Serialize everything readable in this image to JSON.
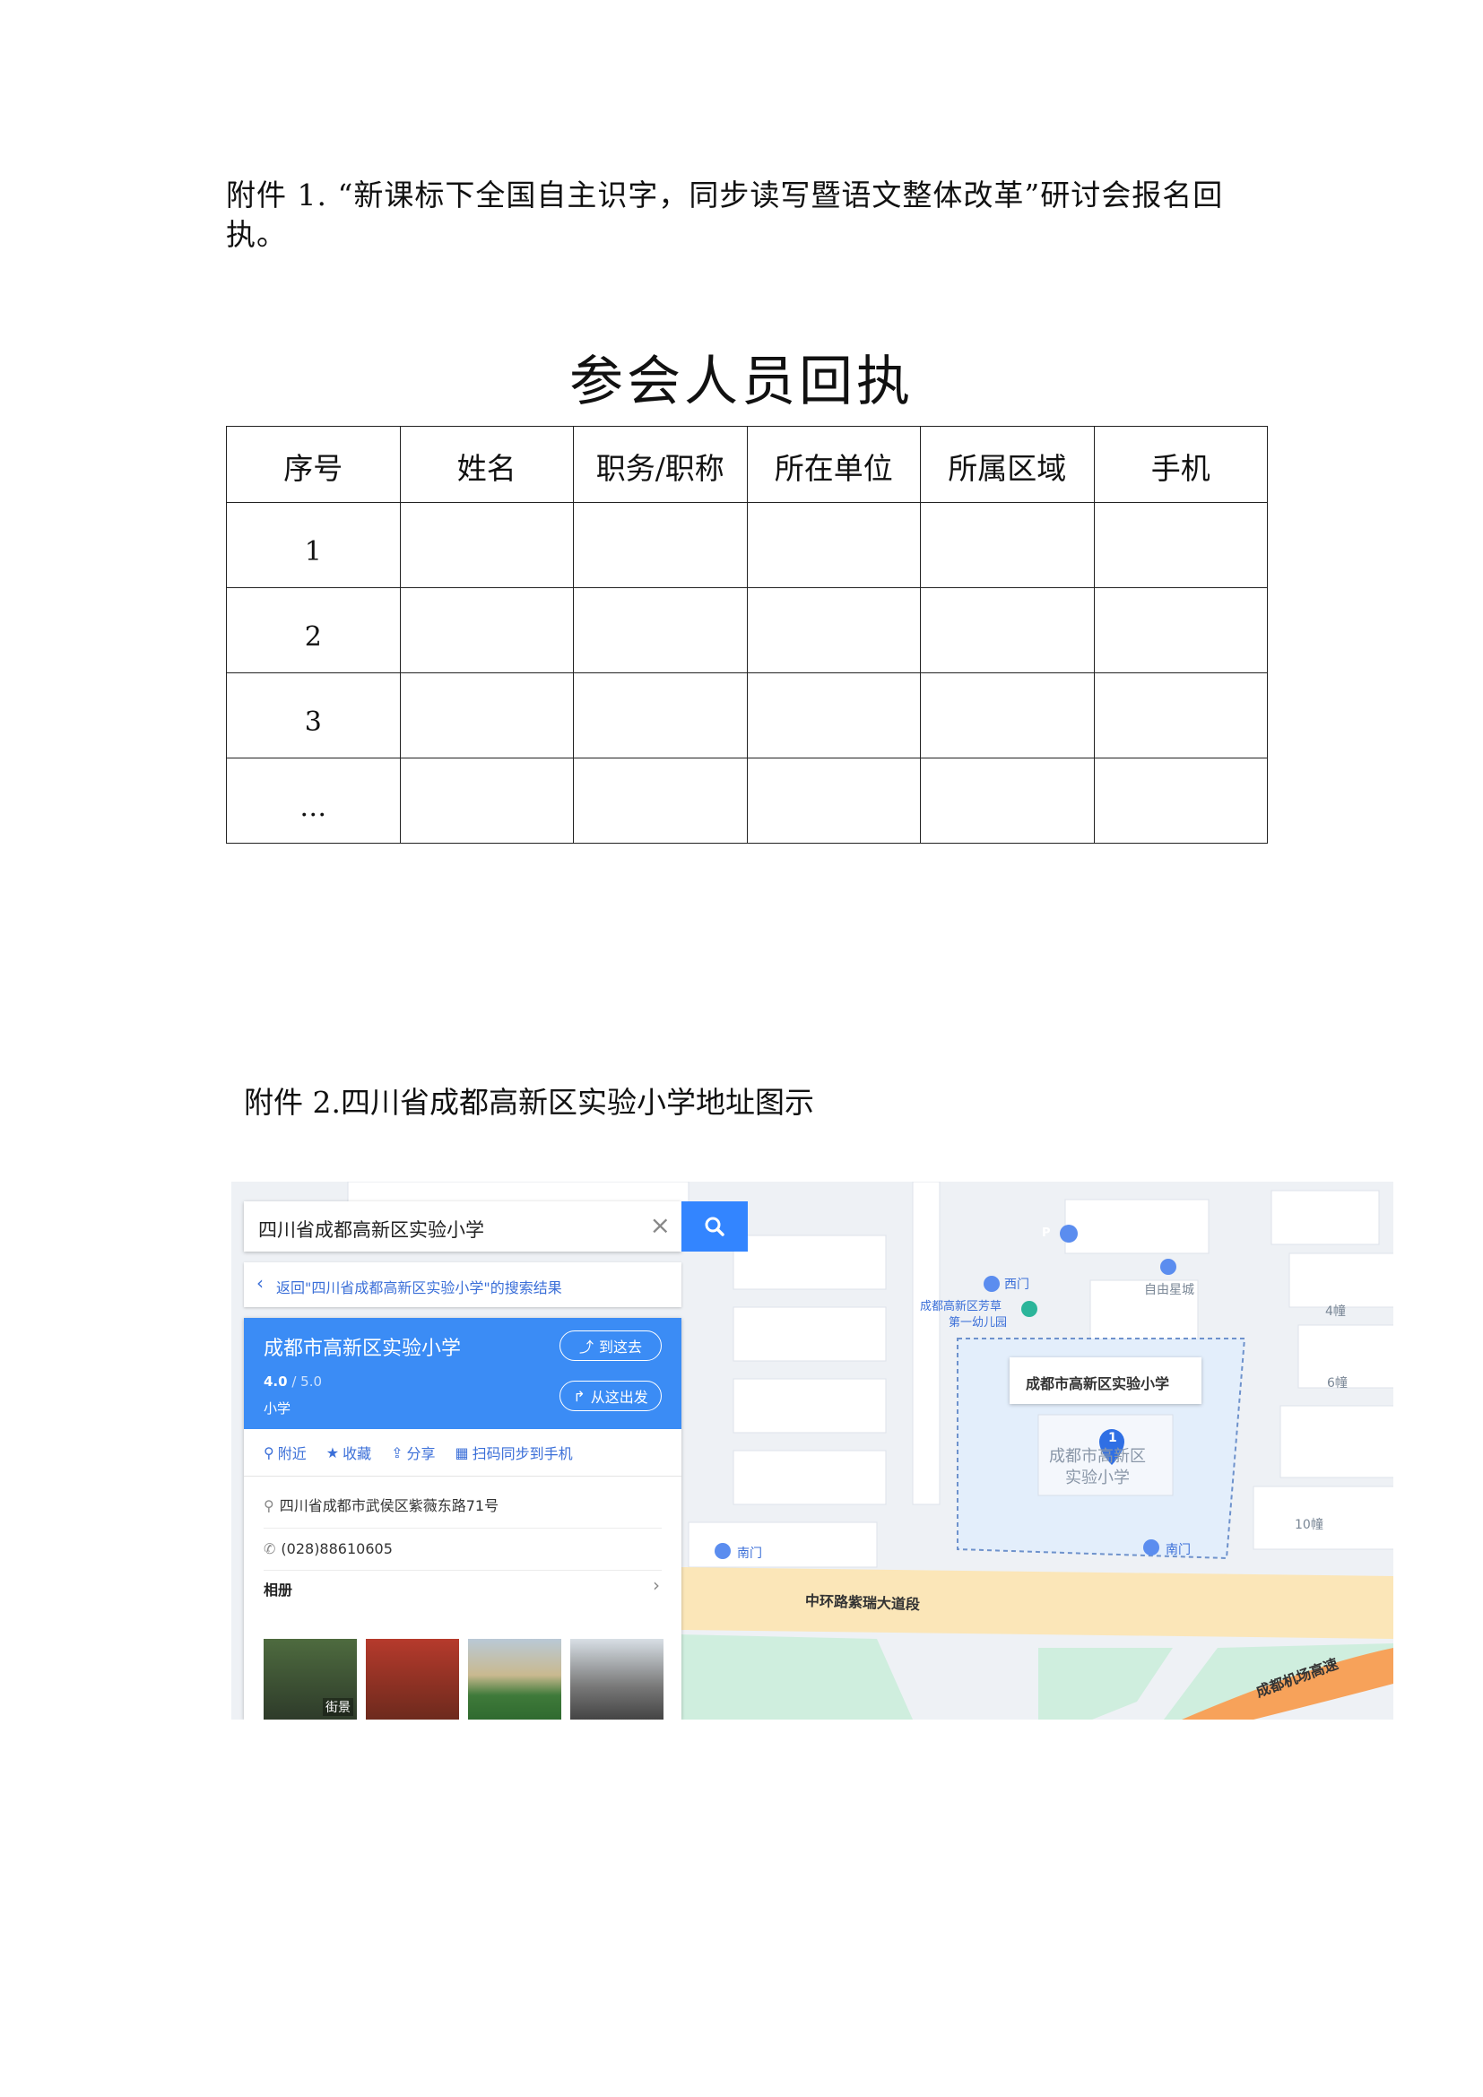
{
  "attachment1": {
    "text": "附件 1. “新课标下全国自主识字，同步读写暨语文整体改革”研讨会报名回执。"
  },
  "form": {
    "title": "参会人员回执",
    "headers": [
      "序号",
      "姓名",
      "职务/职称",
      "所在单位",
      "所属区域",
      "手机"
    ],
    "rows": [
      "1",
      "2",
      "3",
      "…"
    ]
  },
  "attachment2": {
    "text": "附件 2.四川省成都高新区实验小学地址图示"
  },
  "map": {
    "search": {
      "query": "四川省成都高新区实验小学",
      "back_label": "返回\"四川省成都高新区实验小学\"的搜索结果"
    },
    "place": {
      "name": "成都市高新区实验小学",
      "rating": "4.0",
      "rating_max": "/ 5.0",
      "category": "小学",
      "go_here": "到这去",
      "depart_here": "从这出发",
      "actions": [
        "附近",
        "收藏",
        "分享",
        "扫码同步到手机"
      ],
      "address": "四川省成都市武侯区紫薇东路71号",
      "phone": "(028)88610605",
      "album": "相册",
      "street_view": "街景"
    },
    "labels": {
      "west_gate": "西门",
      "kindergarten_1": "成都高新区芳草",
      "kindergarten_2": "第一幼儿园",
      "ziyou": "自由星城",
      "b4": "4幢",
      "b6": "6幢",
      "b10": "10幢",
      "callout": "成都市高新区实验小学",
      "school_line1": "成都市高新区",
      "school_line2": "实验小学",
      "south_gate": "南门",
      "south_gate2": "南门",
      "road": "中环路紫瑞大道段",
      "expressway": "成都机场高速",
      "pin": "1"
    },
    "colors": {
      "accent": "#3385ff",
      "card_header": "#3b8cf5",
      "road": "#fbe6b8",
      "expressway": "#f7a25a"
    }
  }
}
